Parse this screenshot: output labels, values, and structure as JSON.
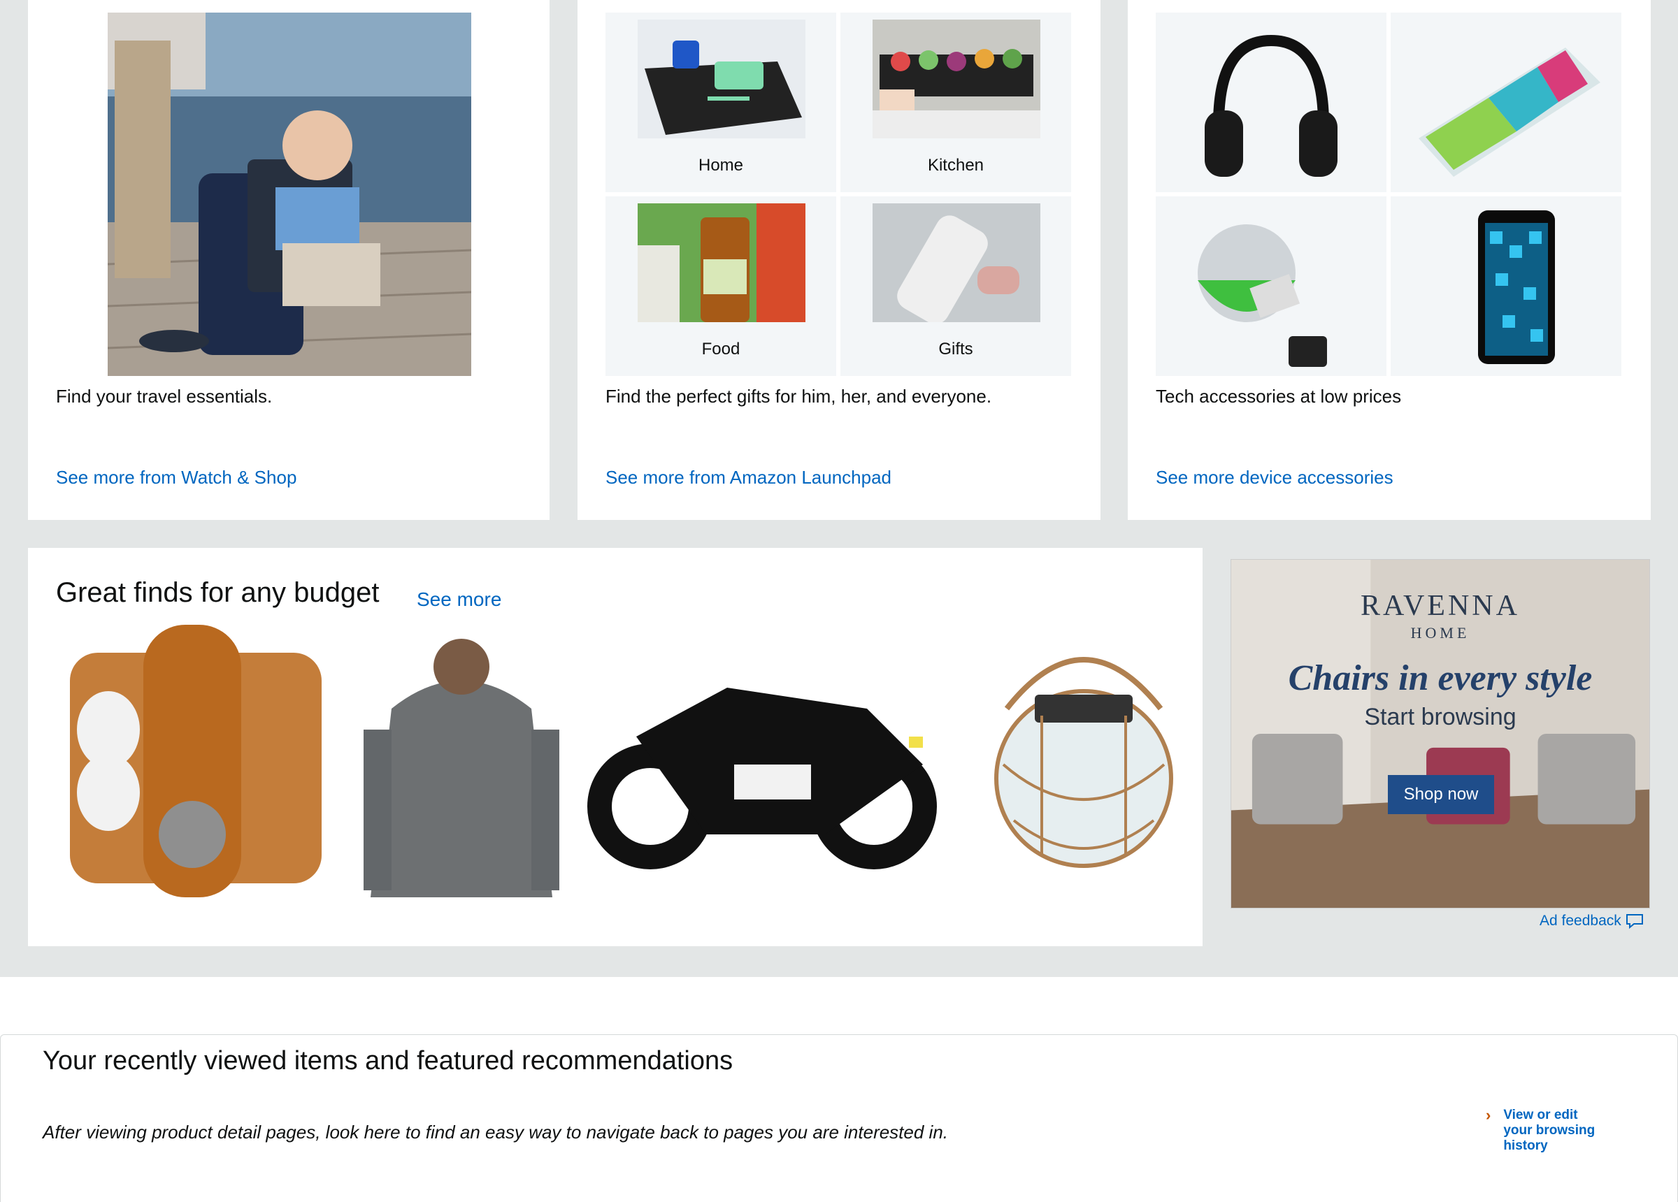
{
  "cards": [
    {
      "caption": "Find your travel essentials.",
      "link": "See more from Watch & Shop"
    },
    {
      "caption": "Find the perfect gifts for him, her, and everyone.",
      "link": "See more from Amazon Launchpad",
      "tiles": [
        "Home",
        "Kitchen",
        "Food",
        "Gifts"
      ]
    },
    {
      "caption": "Tech accessories at low prices",
      "link": "See more device accessories"
    }
  ],
  "budget": {
    "title": "Great finds for any budget",
    "see_more": "See more",
    "items": [
      "cable-organizer",
      "hoodie",
      "motorcycle-usb",
      "solar-jar-light"
    ]
  },
  "ad": {
    "brand": "RAVENNA",
    "brand_sub": "HOME",
    "headline": "Chairs in every style",
    "sub": "Start browsing",
    "cta": "Shop now",
    "feedback": "Ad feedback"
  },
  "recent": {
    "title": "Your recently viewed items and featured recommendations",
    "description": "After viewing product detail pages, look here to find an easy way to navigate back to pages you are interested in.",
    "history_chevron": "›",
    "history_link": "View or edit your browsing history"
  },
  "colors": {
    "link": "#0066c0",
    "page_bg": "#e3e6e6",
    "ad_button": "#1f4d8a",
    "chevron": "#c45500"
  }
}
